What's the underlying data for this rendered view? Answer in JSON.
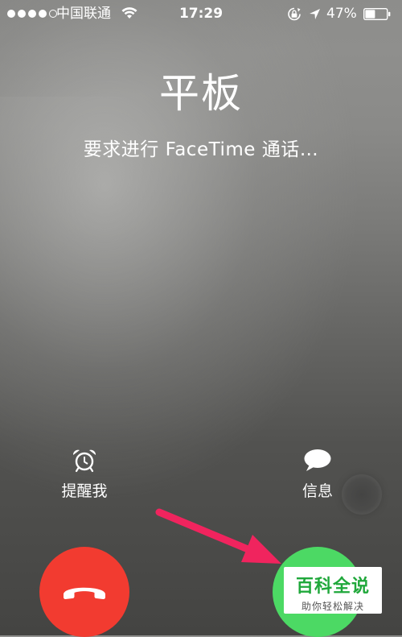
{
  "status_bar": {
    "signal_dots": 5,
    "signal_filled": 4,
    "carrier": "中国联通",
    "time": "17:29",
    "battery_percent": "47%",
    "battery_level": 0.47
  },
  "call": {
    "caller": "平板",
    "status": "要求进行 FaceTime 通话…"
  },
  "actions": {
    "remind_label": "提醒我",
    "message_label": "信息"
  },
  "buttons": {
    "decline_color": "#f23b30",
    "accept_color": "#4cd964"
  },
  "annotation": {
    "arrow_color": "#f0245e"
  },
  "watermark": {
    "title": "百科全说",
    "subtitle": "助你轻松解决"
  },
  "icons": [
    "wifi-icon",
    "rotation-lock-icon",
    "location-icon",
    "battery-icon",
    "alarm-clock-icon",
    "speech-bubble-icon",
    "phone-hangup-icon"
  ]
}
